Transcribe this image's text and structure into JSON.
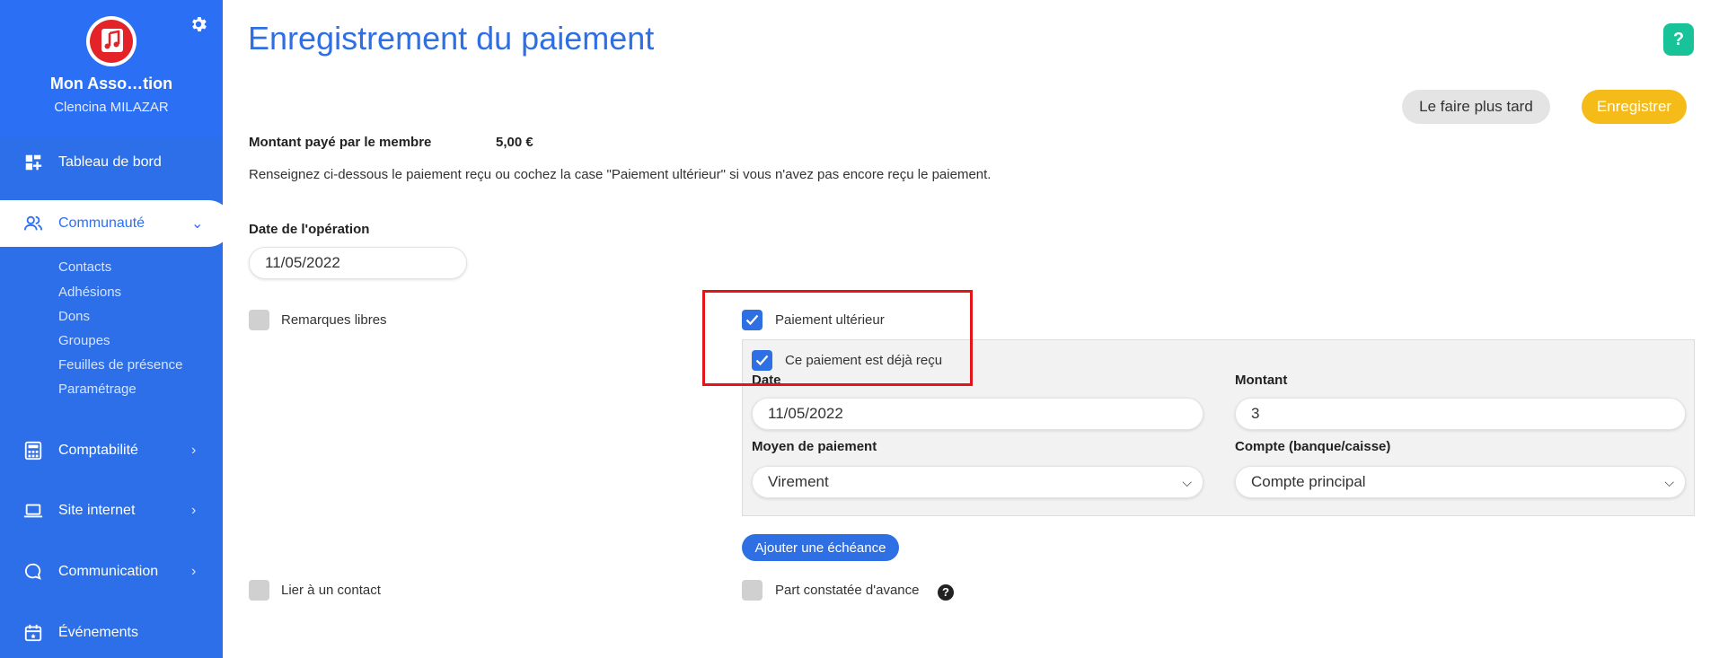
{
  "sidebar": {
    "org_name": "Mon Asso…tion",
    "user_name": "Clencina MILAZAR",
    "items": [
      {
        "label": "Tableau de bord",
        "icon": "dashboard-icon"
      },
      {
        "label": "Communauté",
        "icon": "users-icon",
        "chevron": "⌄"
      },
      {
        "label": "Comptabilité",
        "icon": "calculator-icon",
        "chevron": "›"
      },
      {
        "label": "Site internet",
        "icon": "laptop-icon",
        "chevron": "›"
      },
      {
        "label": "Communication",
        "icon": "chat-icon",
        "chevron": "›"
      },
      {
        "label": "Événements",
        "icon": "calendar-icon"
      }
    ],
    "sub_items": [
      "Contacts",
      "Adhésions",
      "Dons",
      "Groupes",
      "Feuilles de présence",
      "Paramétrage"
    ]
  },
  "header": {
    "title": "Enregistrement du paiement",
    "help": "?",
    "later_label": "Le faire plus tard",
    "save_label": "Enregistrer"
  },
  "form": {
    "amount_label": "Montant payé par le membre",
    "amount_value": "5,00 €",
    "instructions": "Renseignez ci-dessous le paiement reçu ou cochez la case \"Paiement ultérieur\" si vous n'avez pas encore reçu le paiement.",
    "date_label": "Date de l'opération",
    "date_value": "11/05/2022",
    "remarks_label": "Remarques libres",
    "link_contact_label": "Lier à un contact",
    "later_payment_label": "Paiement ultérieur",
    "later_payment_checked": true,
    "received_label": "Ce paiement est déjà reçu",
    "received_checked": true,
    "pay_date_label": "Date",
    "pay_date_value": "11/05/2022",
    "montant_label": "Montant",
    "montant_value": "3",
    "method_label": "Moyen de paiement",
    "method_value": "Virement",
    "account_label": "Compte (banque/caisse)",
    "account_value": "Compte principal",
    "add_echeance_label": "Ajouter une échéance",
    "advance_label": "Part constatée d'avance",
    "advance_help": "?"
  },
  "colors": {
    "sidebar": "#2d6fe8",
    "accent": "#2f6fe4",
    "save": "#f5bb19",
    "highlight": "#e5141b"
  }
}
